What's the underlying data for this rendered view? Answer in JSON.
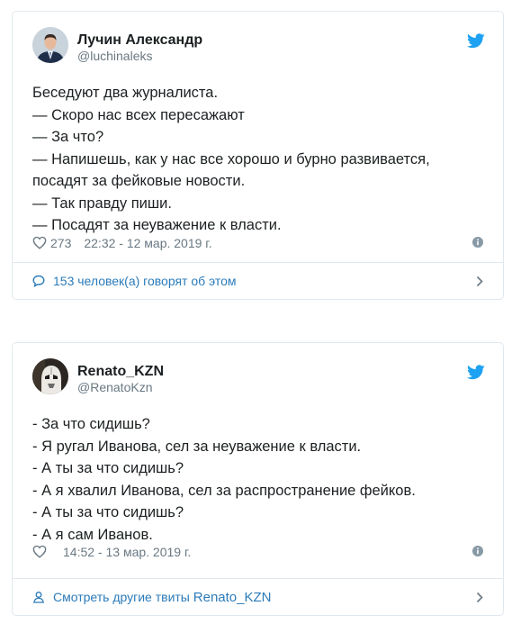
{
  "colors": {
    "twitter_blue": "#1da1f2",
    "link": "#2b7bb9",
    "muted": "#697882",
    "text": "#1c2022",
    "border": "#e1e8ed"
  },
  "tweets": [
    {
      "author": {
        "name": "Лучин Александр",
        "handle": "@luchinaleks",
        "avatar_icon": "person-in-suit-avatar"
      },
      "brand_icon": "twitter-bird-icon",
      "lines": [
        "Беседуют два журналиста.",
        "— Скоро нас всех пересажают",
        "— За что?",
        "— Напишешь, как у нас все хорошо и бурно развивается,",
        "посадят за фейковые новости.",
        "— Так правду пиши.",
        "— Посадят за неуважение к власти."
      ],
      "likes": "273",
      "timestamp": "22:32 - 12 мар. 2019 г.",
      "footer": {
        "icon": "speech-bubble-icon",
        "label": "153 человек(а) говорят об этом"
      }
    },
    {
      "author": {
        "name": "Renato_KZN",
        "handle": "@RenatoKzn",
        "avatar_icon": "stormtrooper-avatar"
      },
      "brand_icon": "twitter-bird-icon",
      "lines": [
        "- За что сидишь?",
        "- Я ругал Иванова, сел за неуважение к власти.",
        "- А ты за что сидишь?",
        "- А я хвалил Иванова, сел за распространение фейков.",
        "- А ты за что сидишь?",
        "- А я сам Иванов."
      ],
      "likes": "",
      "timestamp": "14:52 - 13 мар. 2019 г.",
      "footer": {
        "icon": "person-icon",
        "label_prefix": "Смотреть другие твиты",
        "label_name": "Renato_KZN"
      }
    }
  ]
}
